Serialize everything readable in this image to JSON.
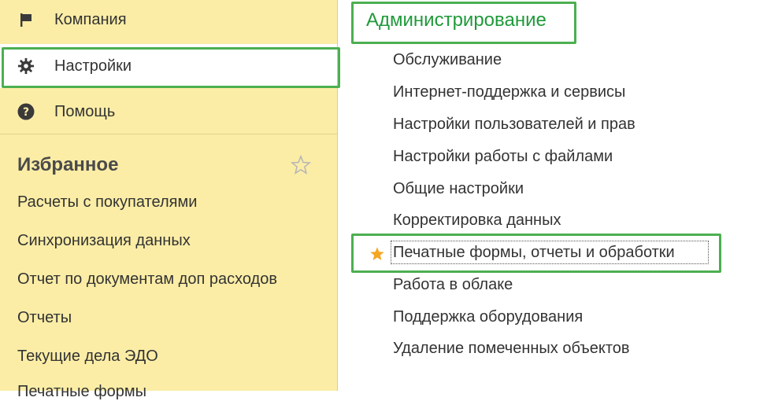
{
  "sidebar": {
    "nav": [
      {
        "label": "Компания",
        "icon": "flag-icon"
      },
      {
        "label": "Настройки",
        "icon": "gear-icon"
      },
      {
        "label": "Помощь",
        "icon": "help-icon"
      }
    ],
    "favorites": {
      "title": "Избранное",
      "star_icon": "star-outline-icon",
      "items": [
        "Расчеты с покупателями",
        "Синхронизация данных",
        "Отчет по документам доп расходов",
        "Отчеты",
        "Текущие дела ЭДО",
        "Печатные формы"
      ]
    }
  },
  "panel": {
    "title": "Администрирование",
    "items": [
      "Обслуживание",
      "Интернет-поддержка и сервисы",
      "Настройки пользователей и прав",
      "Настройки работы с файлами",
      "Общие настройки",
      "Корректировка данных",
      "Печатные формы, отчеты и обработки",
      "Работа в облаке",
      "Поддержка оборудования",
      "Удаление помеченных объектов"
    ],
    "favorite_star_icon": "star-filled-icon"
  },
  "colors": {
    "sidebar_bg": "#fbeda6",
    "highlight_border": "#4caf50",
    "title_green": "#1f9a3a",
    "star_orange": "#f5a623"
  }
}
